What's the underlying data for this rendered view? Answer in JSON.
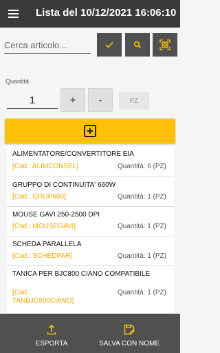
{
  "header": {
    "title": "Lista del 10/12/2021 16:06:10"
  },
  "search": {
    "placeholder": "Cerca articolo..."
  },
  "quantity": {
    "label": "Quantità",
    "value": "1",
    "plus": "+",
    "minus": "-",
    "unit": "PZ"
  },
  "items": [
    {
      "name": "ALIMENTATORE/CONVERTITORE EIA",
      "code": "[Cod.: ALIMCONSEL]",
      "qty": "Quantità: 6 (PZ)"
    },
    {
      "name": "GRUPPO DI CONTINUITA'  660W",
      "code": "[Cod.: GRUP660]",
      "qty": "Quantità: 1 (PZ)"
    },
    {
      "name": "MOUSE GAVI 250-2500 DPI",
      "code": "[Cod.: MOUSEGAVI]",
      "qty": "Quantità: 1 (PZ)"
    },
    {
      "name": "SCHEDA PARALLELA",
      "code": "[Cod.: SCHEDPAR]",
      "qty": "Quantità: 1 (PZ)"
    },
    {
      "name": "TANICA PER BJC800 CIANO COMPATIBILE",
      "code": "[Cod.: TANBJC800CIANO]",
      "code_line1": "[Cod.:",
      "code_line2": "TANBJC800CIANO]",
      "qty": "Quantità: 1 (PZ)"
    }
  ],
  "bottom": {
    "export_label": "ESPORTA",
    "save_label": "SALVA CON NOME"
  },
  "colors": {
    "accent": "#ffc107",
    "appbar": "#3a3a3a",
    "toolbar": "#505050",
    "code_text": "#f2a900"
  },
  "icons": {
    "menu": "menu-icon",
    "confirm": "check-icon",
    "search": "search-icon",
    "scan": "qr-scan-icon",
    "add": "add-box-icon",
    "export": "upload-icon",
    "save": "save-edit-icon"
  }
}
